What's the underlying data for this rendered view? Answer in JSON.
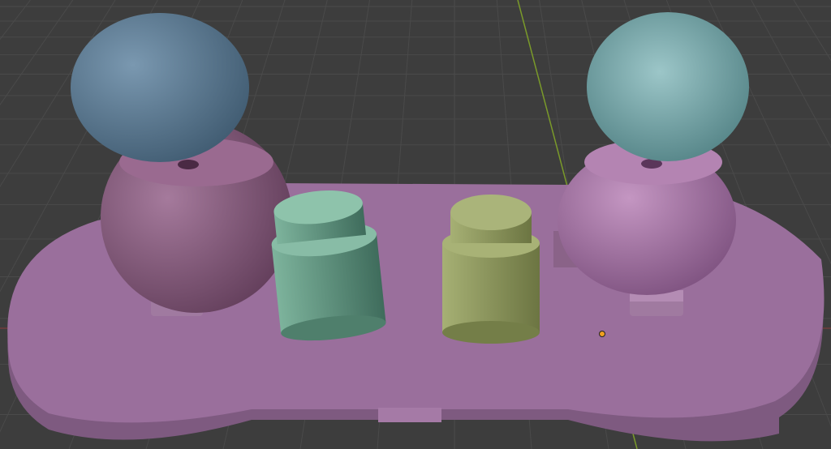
{
  "viewport": {
    "background": "#3d3d3d",
    "grid_color": "#4a4a4a",
    "y_axis_color": "#7a9a2a",
    "x_axis_color": "#8a3a3a",
    "origin_color": "#f0a020"
  },
  "objects": [
    {
      "name": "base-plate",
      "color": "#9a6f9c",
      "side": "#7e5a80"
    },
    {
      "name": "left-ball-top",
      "color": "#5d7d96"
    },
    {
      "name": "left-socket",
      "color": "#8f5f86"
    },
    {
      "name": "right-ball-top",
      "color": "#73a3a6"
    },
    {
      "name": "right-socket",
      "color": "#a272a2"
    },
    {
      "name": "green-button",
      "color": "#6a9a86"
    },
    {
      "name": "yellow-button",
      "color": "#909b62"
    }
  ]
}
